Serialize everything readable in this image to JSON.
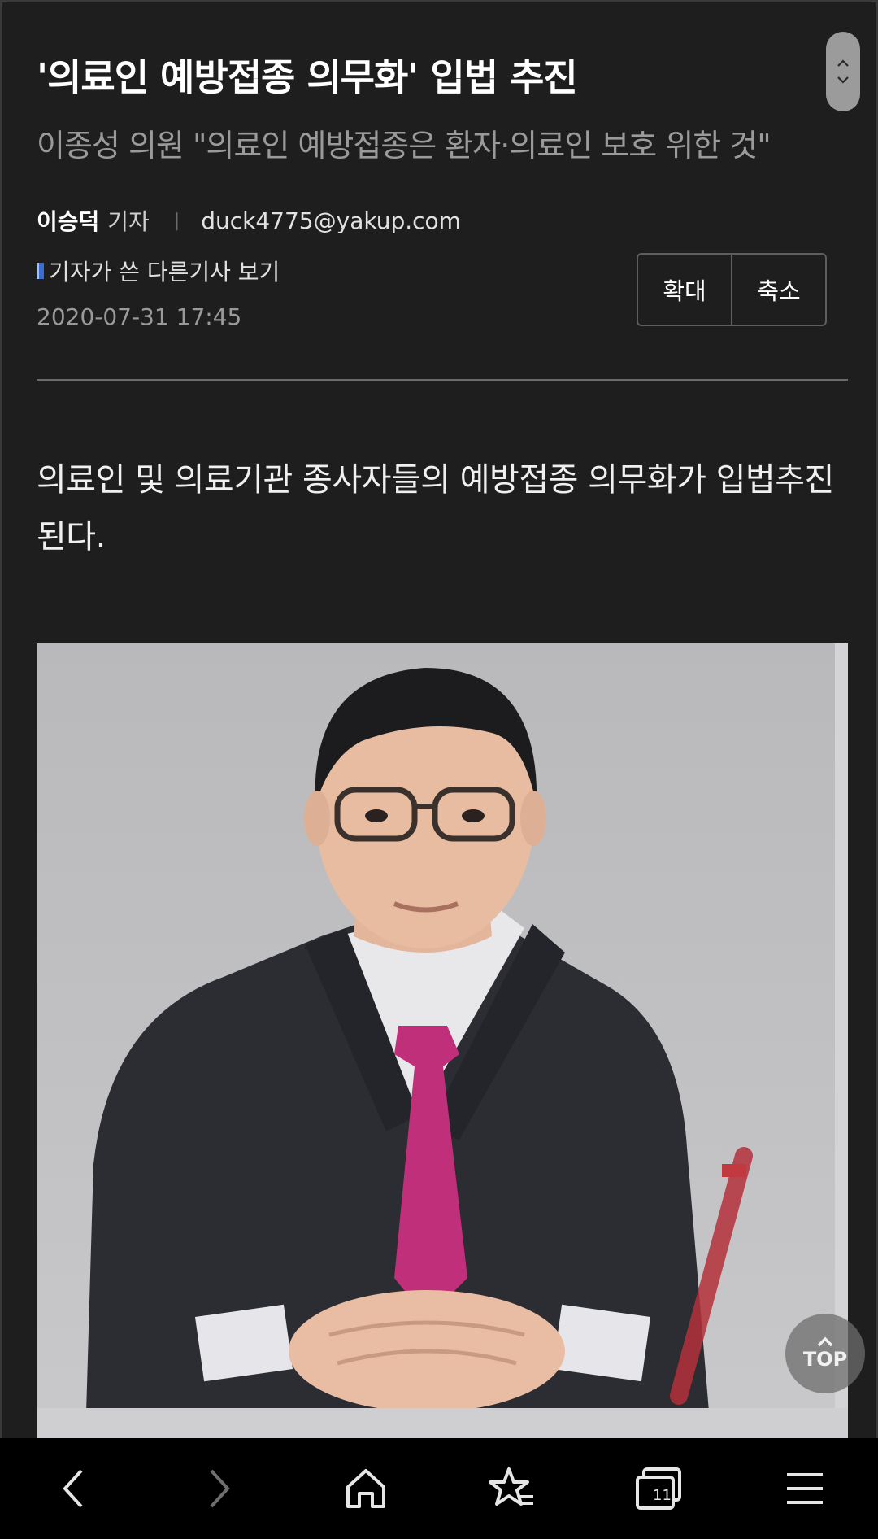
{
  "article": {
    "title": "'의료인 예방접종 의무화' 입법 추진",
    "subtitle": "이종성 의원 \"의료인 예방접종은 환자·의료인 보호 위한 것\"",
    "author_name": "이승덕",
    "author_role": "기자",
    "separator": "|",
    "author_email": "duck4775@yakup.com",
    "more_articles_link": "기자가 쓴 다른기사 보기",
    "date": "2020-07-31 17:45",
    "lead": "의료인 및 의료기관 종사자들의 예방접종 의무화가 입법추진된다."
  },
  "zoom": {
    "zoom_in_label": "확대",
    "zoom_out_label": "축소"
  },
  "top_button": {
    "label": "TOP"
  },
  "browser_bar": {
    "tab_count": "11",
    "icons": [
      "back-icon",
      "forward-icon",
      "home-icon",
      "bookmark-star-icon",
      "tabs-icon",
      "menu-icon"
    ]
  },
  "colors": {
    "background": "#1e1e1e",
    "title": "#ffffff",
    "subtitle": "#9a9a9a",
    "bottom_bar": "#000000",
    "tie": "#c0307a"
  }
}
